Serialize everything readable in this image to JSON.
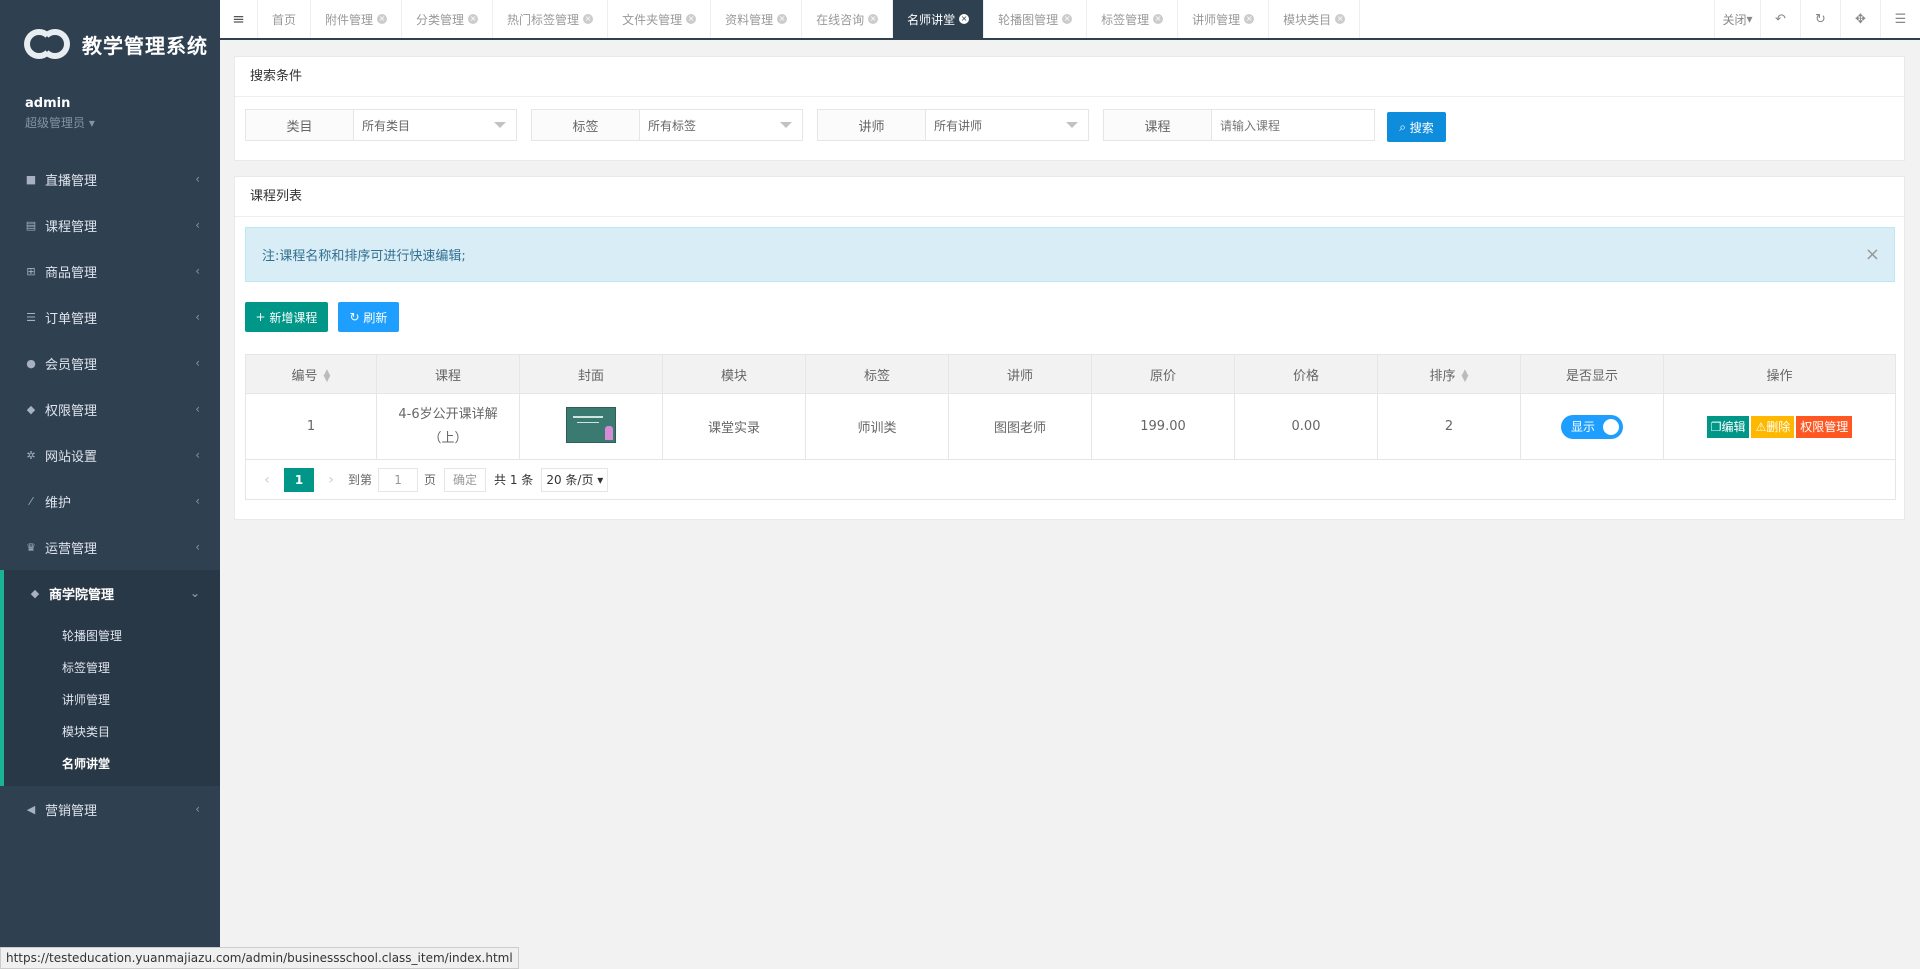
{
  "app": {
    "title": "教学管理系统"
  },
  "user": {
    "name": "admin",
    "role": "超级管理员"
  },
  "sidebar": {
    "items": [
      {
        "label": "直播管理",
        "icon": "video-icon"
      },
      {
        "label": "课程管理",
        "icon": "book-icon"
      },
      {
        "label": "商品管理",
        "icon": "cart-icon"
      },
      {
        "label": "订单管理",
        "icon": "list-icon"
      },
      {
        "label": "会员管理",
        "icon": "user-icon"
      },
      {
        "label": "权限管理",
        "icon": "users-icon"
      },
      {
        "label": "网站设置",
        "icon": "gear-icon"
      },
      {
        "label": "维护",
        "icon": "magic-icon"
      },
      {
        "label": "运营管理",
        "icon": "trophy-icon"
      }
    ],
    "active": {
      "label": "商学院管理",
      "icon": "users-icon"
    },
    "submenu": [
      "轮播图管理",
      "标签管理",
      "讲师管理",
      "模块类目",
      "名师讲堂"
    ],
    "after": {
      "label": "营销管理",
      "icon": "bullhorn-icon"
    }
  },
  "tabs": [
    "首页",
    "附件管理",
    "分类管理",
    "热门标签管理",
    "文件夹管理",
    "资料管理",
    "在线咨询",
    "名师讲堂",
    "轮播图管理",
    "标签管理",
    "讲师管理",
    "模块类目"
  ],
  "active_tab": "名师讲堂",
  "topbar": {
    "close_label": "关闭"
  },
  "search": {
    "title": "搜索条件",
    "fields": [
      {
        "label": "类目",
        "value": "所有类目"
      },
      {
        "label": "标签",
        "value": "所有标签"
      },
      {
        "label": "讲师",
        "value": "所有讲师"
      },
      {
        "label": "课程",
        "placeholder": "请输入课程"
      }
    ],
    "button": "搜索"
  },
  "list": {
    "title": "课程列表",
    "notice": "注:课程名称和排序可进行快速编辑;",
    "add_button": "新增课程",
    "refresh_button": "刷新",
    "columns": [
      "编号",
      "课程",
      "封面",
      "模块",
      "标签",
      "讲师",
      "原价",
      "价格",
      "排序",
      "是否显示",
      "操作"
    ],
    "rows": [
      {
        "id": "1",
        "course": "4-6岁公开课详解（上）",
        "module": "课堂实录",
        "tag": "师训类",
        "teacher": "图图老师",
        "orig_price": "199.00",
        "price": "0.00",
        "sort": "2",
        "show": "显示"
      }
    ],
    "actions": {
      "edit": "编辑",
      "delete": "删除",
      "perm": "权限管理"
    }
  },
  "pager": {
    "current": "1",
    "goto_label": "到第",
    "page_value": "1",
    "page_unit": "页",
    "confirm": "确定",
    "total": "共 1 条",
    "size": "20 条/页"
  },
  "status_url": "https://testeducation.yuanmajiazu.com/admin/businessschool.class_item/index.html",
  "colors": {
    "sidebar": "#2f4050",
    "primary": "#009688",
    "blue": "#1e9fff",
    "warn": "#ffb800",
    "danger": "#ff5722"
  }
}
